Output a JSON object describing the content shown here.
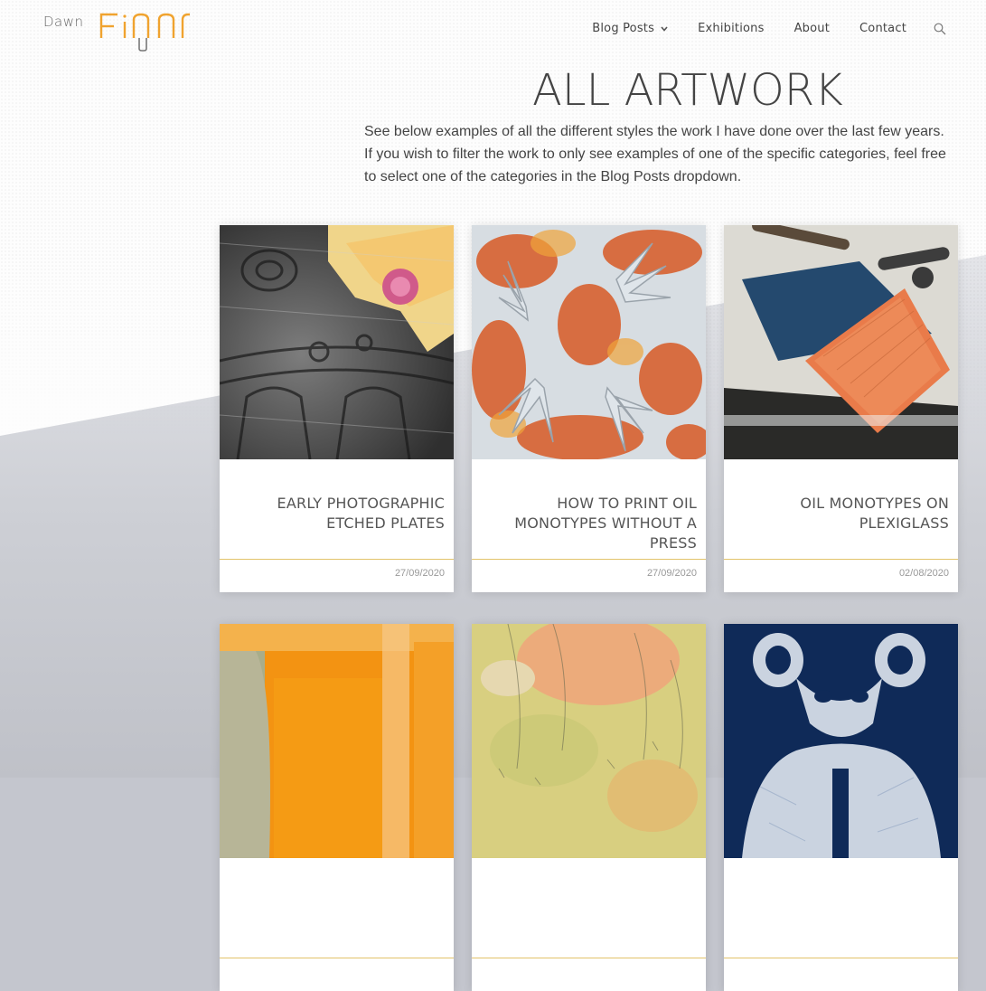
{
  "header": {
    "logo_first": "Dawn",
    "logo_last": "Finn",
    "nav": [
      {
        "label": "Blog Posts",
        "has_dropdown": true
      },
      {
        "label": "Exhibitions"
      },
      {
        "label": "About"
      },
      {
        "label": "Contact"
      }
    ],
    "search_icon": "search-icon"
  },
  "page": {
    "title": "ALL ARTWORK",
    "intro": "See below examples of all the different styles the work I have done over the last few years. If you wish to filter the work to only see examples of one of the specific categories, feel free to select one of the categories in the Blog Posts dropdown."
  },
  "posts": [
    {
      "title": "EARLY PHOTOGRAPHIC ETCHED PLATES",
      "date": "27/09/2020",
      "image": "etching-grey-with-rose"
    },
    {
      "title": "HOW TO PRINT OIL MONOTYPES WITHOUT A PRESS",
      "date": "27/09/2020",
      "image": "orange-hands-monotype"
    },
    {
      "title": "OIL MONOTYPES ON PLEXIGLASS",
      "date": "02/08/2020",
      "image": "rollers-on-plexiglass"
    },
    {
      "title": "",
      "date": "",
      "image": "orange-abstract"
    },
    {
      "title": "",
      "date": "",
      "image": "yellow-orange-abstract"
    },
    {
      "title": "",
      "date": "",
      "image": "blue-cyanotype-figure"
    }
  ],
  "colors": {
    "accent": "#f0a32f",
    "card_rule": "#e2c36a",
    "background_lower": "#c4c6ce"
  }
}
